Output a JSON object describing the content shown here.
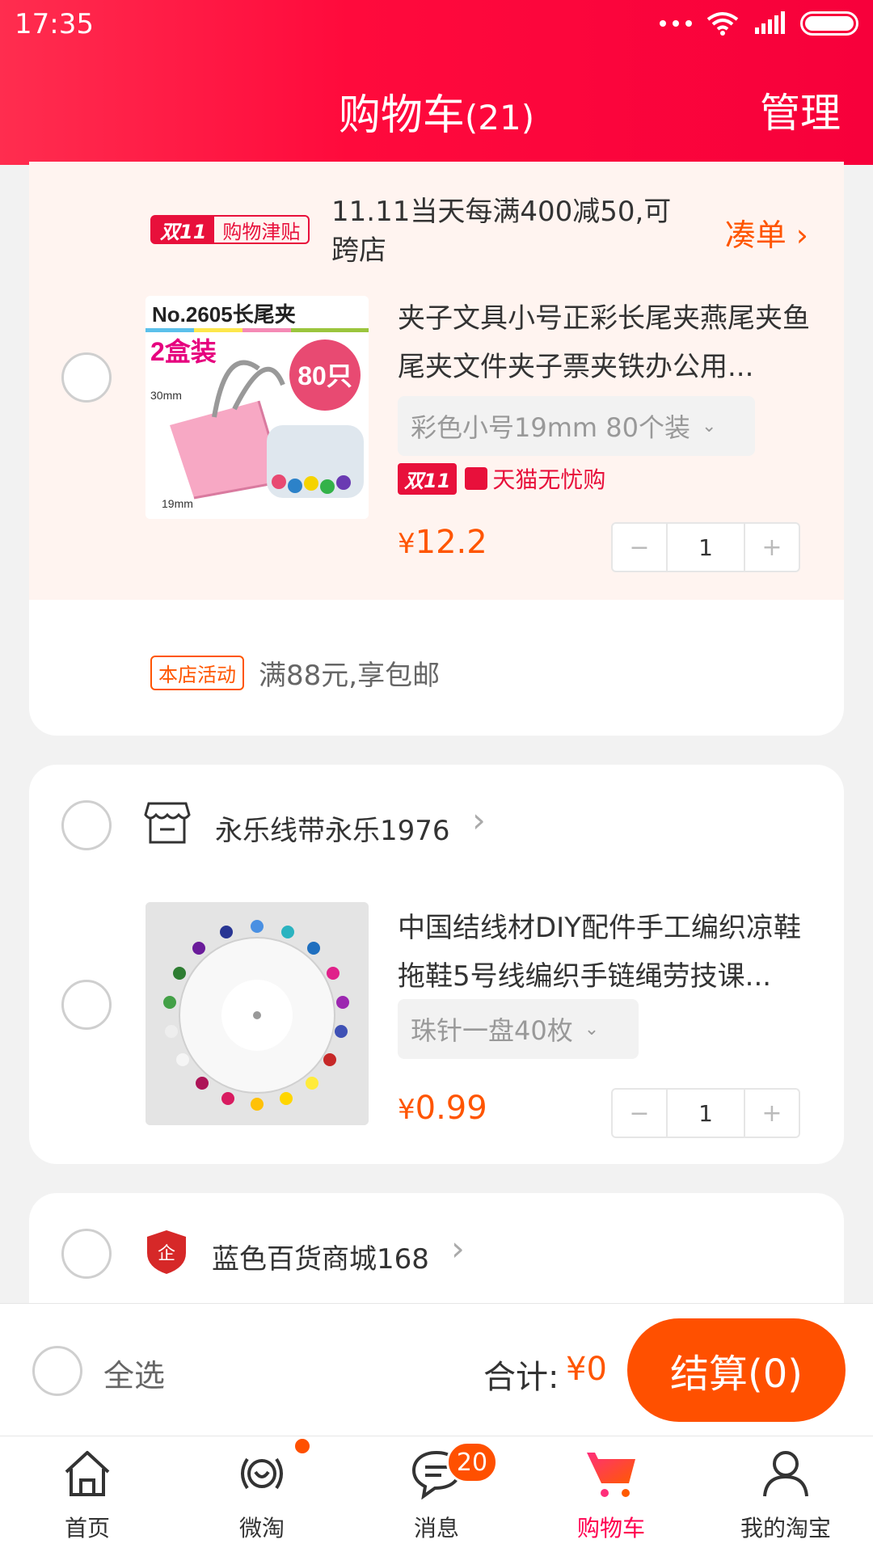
{
  "status_bar": {
    "time": "17:35"
  },
  "header": {
    "title": "购物车",
    "count": "(21)",
    "manage": "管理"
  },
  "promo": {
    "badge_11": "双11",
    "badge_label": "购物津贴",
    "text": "11.11当天每满400减50,可跨店",
    "link": "凑单"
  },
  "items": [
    {
      "title": "夹子文具小号正彩长尾夹燕尾夹鱼尾夹文件夹子票夹铁办公用...",
      "sku": "彩色小号19mm 80个装",
      "badge_11": "双11",
      "tmall": "天猫无忧购",
      "currency": "¥",
      "price": "12.2",
      "qty": "1",
      "thumb_text_main": "No.2605长尾夹",
      "thumb_text_box": "2盒装",
      "thumb_text_count": "80只",
      "thumb_dim_30": "30mm",
      "thumb_dim_19": "19mm"
    },
    {
      "title": "中国结线材DIY配件手工编织凉鞋拖鞋5号线编织手链绳劳技课...",
      "sku": "珠针一盘40枚",
      "currency": "¥",
      "price": "0.99",
      "qty": "1"
    }
  ],
  "shop_activity": {
    "tag": "本店活动",
    "text": "满88元,享包邮"
  },
  "shops": [
    {
      "name": "永乐线带永乐1976"
    },
    {
      "name": "蓝色百货商城168"
    }
  ],
  "stepper": {
    "minus": "−",
    "plus": "+"
  },
  "footer": {
    "select_all": "全选",
    "total_label": "合计:",
    "total_value": "¥0",
    "checkout": "结算(0)"
  },
  "tabs": [
    {
      "label": "首页",
      "icon": "home-icon"
    },
    {
      "label": "微淘",
      "icon": "weitao-icon"
    },
    {
      "label": "消息",
      "icon": "message-icon",
      "badge": "20"
    },
    {
      "label": "购物车",
      "icon": "cart-icon",
      "active": true
    },
    {
      "label": "我的淘宝",
      "icon": "profile-icon"
    }
  ],
  "colors": {
    "header": "#ff0a3c",
    "accent": "#ff5500",
    "active_tab": "#ff0050"
  }
}
